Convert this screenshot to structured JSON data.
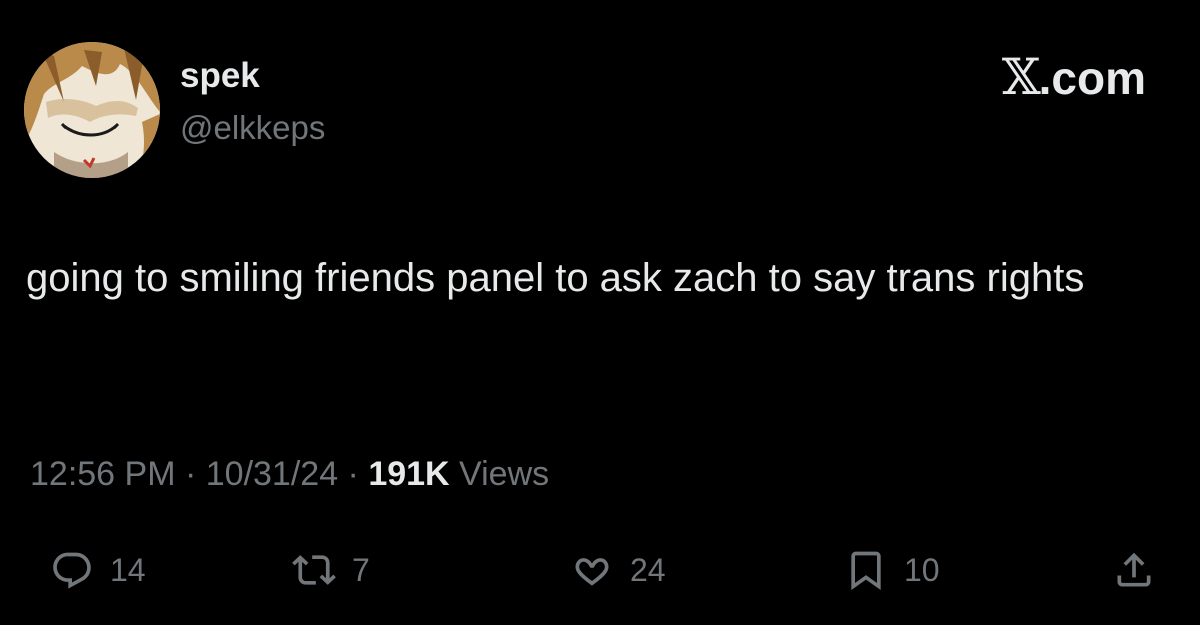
{
  "author": {
    "display_name": "spek",
    "handle": "@elkkeps",
    "avatar_icon": "anime-face-avatar-icon"
  },
  "brand": {
    "x_glyph": "𝕏",
    "domain": ".com"
  },
  "tweet": {
    "text": "going to smiling friends panel to ask zach to say trans rights"
  },
  "meta": {
    "time": "12:56 PM",
    "sep1": " · ",
    "date": "10/31/24",
    "sep2": " · ",
    "views_count": "191K",
    "views_label": " Views"
  },
  "actions": {
    "reply": {
      "icon": "reply-icon",
      "count": "14"
    },
    "repost": {
      "icon": "repost-icon",
      "count": "7"
    },
    "like": {
      "icon": "heart-icon",
      "count": "24"
    },
    "bookmark": {
      "icon": "bookmark-icon",
      "count": "10"
    },
    "share": {
      "icon": "share-icon"
    }
  },
  "colors": {
    "background": "#000000",
    "primary_text": "#e7e9ea",
    "secondary_text": "#71767b"
  }
}
